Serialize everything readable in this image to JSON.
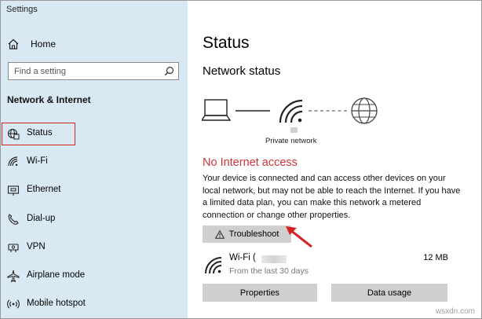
{
  "window": {
    "title": "Settings"
  },
  "sidebar": {
    "home_label": "Home",
    "search_placeholder": "Find a setting",
    "section_heading": "Network & Internet",
    "items": [
      {
        "label": "Status",
        "icon": "globe-network-icon",
        "selected": true
      },
      {
        "label": "Wi-Fi",
        "icon": "wifi-icon"
      },
      {
        "label": "Ethernet",
        "icon": "ethernet-icon"
      },
      {
        "label": "Dial-up",
        "icon": "dialup-icon"
      },
      {
        "label": "VPN",
        "icon": "vpn-icon"
      },
      {
        "label": "Airplane mode",
        "icon": "airplane-icon"
      },
      {
        "label": "Mobile hotspot",
        "icon": "hotspot-icon"
      }
    ]
  },
  "main": {
    "title": "Status",
    "network_status_heading": "Network status",
    "diagram": {
      "network_label": "Private network",
      "icons": [
        "laptop-icon",
        "wifi-icon",
        "globe-icon"
      ]
    },
    "alert": {
      "title": "No Internet access",
      "color": "#d13438"
    },
    "description": "Your device is connected and can access other devices on your local network, but may not be able to reach the Internet. If you have a limited data plan, you can make this network a metered connection or change other properties.",
    "troubleshoot_label": "Troubleshoot",
    "connection": {
      "name": "Wi-Fi (",
      "period": "From the last 30 days",
      "usage": "12 MB"
    },
    "properties_label": "Properties",
    "data_usage_label": "Data usage"
  },
  "watermark": "wsxdn.com",
  "colors": {
    "sidebar_bg": "#d9e9f3",
    "highlight_box": "#d42222",
    "button_bg": "#cfcfcf"
  }
}
